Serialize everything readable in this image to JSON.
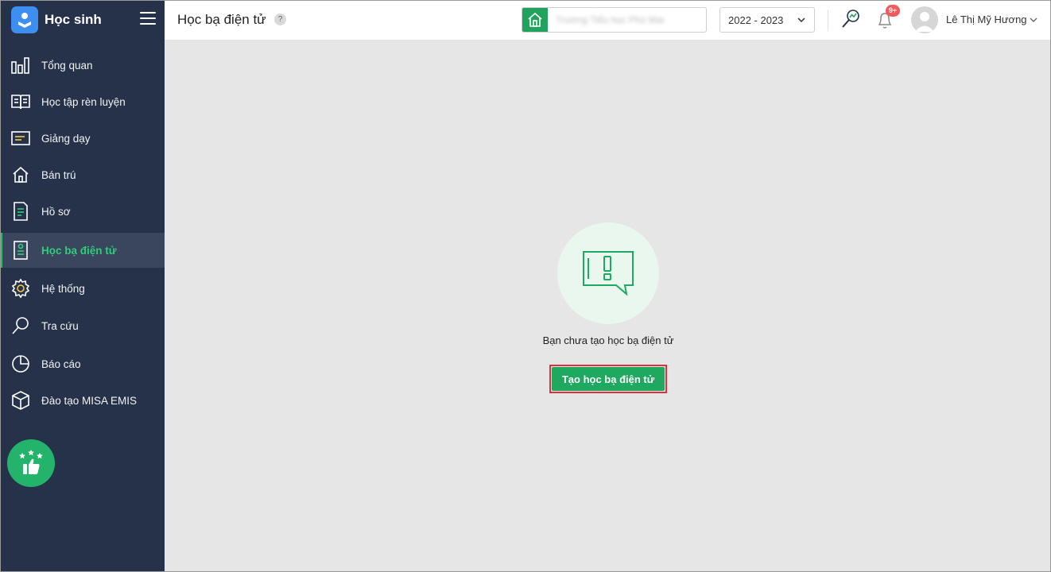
{
  "app": {
    "title": "Học sinh"
  },
  "sidebar": {
    "items": [
      {
        "label": "Tổng quan",
        "icon": "chart-bars-icon"
      },
      {
        "label": "Học tập rèn luyện",
        "icon": "open-book-icon"
      },
      {
        "label": "Giảng dạy",
        "icon": "board-icon"
      },
      {
        "label": "Bán trú",
        "icon": "house-icon"
      },
      {
        "label": "Hồ sơ",
        "icon": "document-icon"
      },
      {
        "label": "Học bạ điện tử",
        "icon": "record-book-icon",
        "active": true
      },
      {
        "label": "Hệ thống",
        "icon": "gear-icon"
      },
      {
        "label": "Tra cứu",
        "icon": "search-icon"
      },
      {
        "label": "Báo cáo",
        "icon": "pie-chart-icon"
      },
      {
        "label": "Đào tạo MISA EMIS",
        "icon": "cube-icon"
      }
    ],
    "feedback_icon": "thumbs-up-stars-icon"
  },
  "header": {
    "page_title": "Học bạ điện tử",
    "help_label": "?",
    "school_name": "Trường Tiểu học Phú Mai",
    "school_year": "2022 - 2023",
    "notification_badge": "9+",
    "user_name": "Lê Thị Mỹ Hương"
  },
  "main": {
    "empty_message": "Bạn chưa tạo học bạ điện tử",
    "create_button_label": "Tạo học bạ điện tử"
  },
  "colors": {
    "sidebar_bg": "#25324a",
    "accent_green": "#1fa85f",
    "highlight_red": "#e0313a",
    "badge_red": "#f25b5b"
  }
}
